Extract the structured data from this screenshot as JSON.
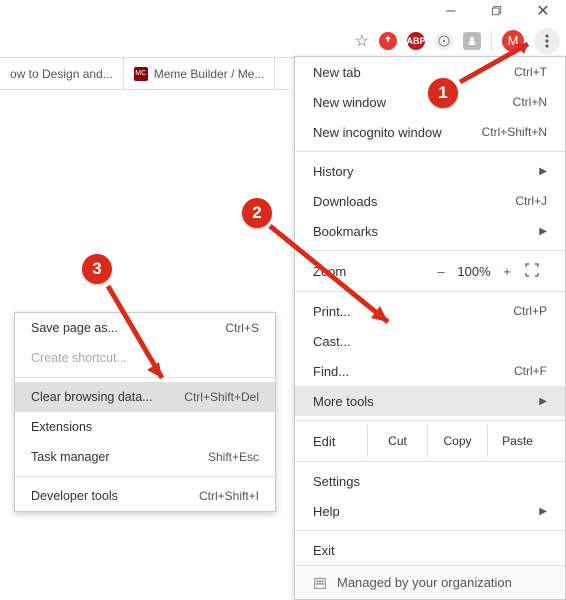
{
  "window": {
    "min": "–",
    "max": "☐",
    "close": "✕"
  },
  "toolbar": {
    "star": "☆",
    "ext": [
      "",
      "ABP",
      "",
      ""
    ],
    "avatar_initial": "M"
  },
  "tabs": [
    {
      "fav": "",
      "label": "ow to Design and..."
    },
    {
      "fav": "MC",
      "label": "Meme Builder / Me..."
    }
  ],
  "menu": {
    "new_tab": {
      "label": "New tab",
      "short": "Ctrl+T"
    },
    "new_window": {
      "label": "New window",
      "short": "Ctrl+N"
    },
    "incognito": {
      "label": "New incognito window",
      "short": "Ctrl+Shift+N"
    },
    "history": {
      "label": "History"
    },
    "downloads": {
      "label": "Downloads",
      "short": "Ctrl+J"
    },
    "bookmarks": {
      "label": "Bookmarks"
    },
    "zoom": {
      "label": "Zoom",
      "minus": "–",
      "value": "100%",
      "plus": "+"
    },
    "print": {
      "label": "Print...",
      "short": "Ctrl+P"
    },
    "cast": {
      "label": "Cast..."
    },
    "find": {
      "label": "Find...",
      "short": "Ctrl+F"
    },
    "more_tools": {
      "label": "More tools"
    },
    "edit": {
      "label": "Edit",
      "cut": "Cut",
      "copy": "Copy",
      "paste": "Paste"
    },
    "settings": {
      "label": "Settings"
    },
    "help": {
      "label": "Help"
    },
    "exit": {
      "label": "Exit"
    },
    "managed": {
      "label": "Managed by your organization"
    }
  },
  "submenu": {
    "save_page": {
      "label": "Save page as...",
      "short": "Ctrl+S"
    },
    "create_shortcut": {
      "label": "Create shortcut..."
    },
    "clear_data": {
      "label": "Clear browsing data...",
      "short": "Ctrl+Shift+Del"
    },
    "extensions": {
      "label": "Extensions"
    },
    "task_manager": {
      "label": "Task manager",
      "short": "Shift+Esc"
    },
    "dev_tools": {
      "label": "Developer tools",
      "short": "Ctrl+Shift+I"
    }
  },
  "annotations": {
    "b1": "1",
    "b2": "2",
    "b3": "3"
  }
}
